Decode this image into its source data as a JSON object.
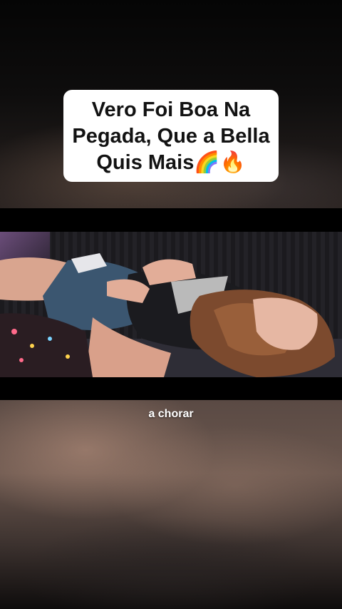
{
  "caption": {
    "line1": "Vero Foi Boa Na",
    "line2": "Pegada, Que a Bella",
    "line3": "Quis Mais",
    "emoji1": "🌈",
    "emoji2": "🔥"
  },
  "video": {
    "subtitle": "a chorar"
  },
  "colors": {
    "caption_bg": "#ffffff",
    "caption_text": "#121212",
    "bars": "#000000"
  }
}
